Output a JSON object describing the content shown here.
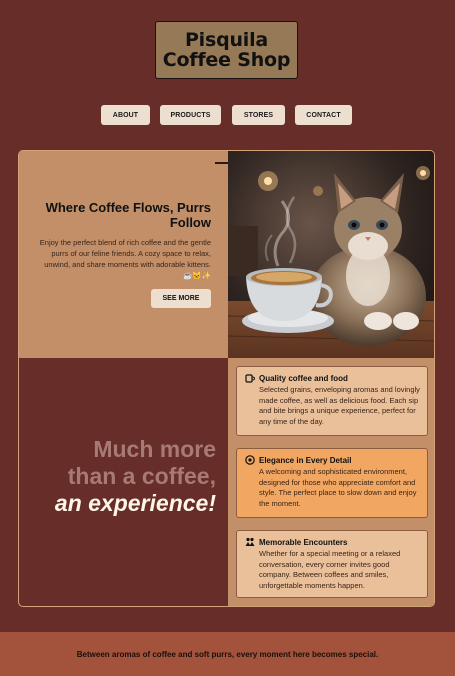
{
  "logo": {
    "line1": "Pisquila",
    "line2": "Coffee Shop"
  },
  "nav": [
    {
      "label": "ABOUT"
    },
    {
      "label": "PRODUCTS"
    },
    {
      "label": "STORES"
    },
    {
      "label": "CONTACT"
    }
  ],
  "hero": {
    "title": "Where Coffee Flows, Purrs Follow",
    "description": "Enjoy the perfect blend of rich coffee and the gentle purrs of our feline friends. A cozy space to relax, unwind, and share moments with adorable kittens. ☕🐱✨",
    "button": "SEE MORE",
    "image_alt": "cat beside a cup of coffee"
  },
  "promo": {
    "line1": "Much more",
    "line2": "than a coffee,",
    "line3": "an experience!"
  },
  "features": [
    {
      "icon": "coffee-cup-icon",
      "title": "Quality coffee and food",
      "description": "Selected grains, enveloping aromas and lovingly made coffee, as well as delicious food. Each sip and bite brings a unique experience, perfect for any time of the day.",
      "bg": "#e9c09a"
    },
    {
      "icon": "compass-icon",
      "title": "Elegance in Every Detail",
      "description": "A welcoming and sophisticated environment, designed for those who appreciate comfort and style. The perfect place to slow down and enjoy the moment.",
      "bg": "#f1a661"
    },
    {
      "icon": "people-icon",
      "title": "Memorable Encounters",
      "description": "Whether for a special meeting or a relaxed conversation, every corner invites good company. Between coffees and smiles, unforgettable moments happen.",
      "bg": "#e9c09a"
    }
  ],
  "footer": {
    "text": "Between aromas of coffee and soft purrs, every moment here becomes special."
  },
  "colors": {
    "background": "#672d29",
    "panel": "#c28f69",
    "footer": "#a3533b",
    "highlight": "#f1a661"
  }
}
